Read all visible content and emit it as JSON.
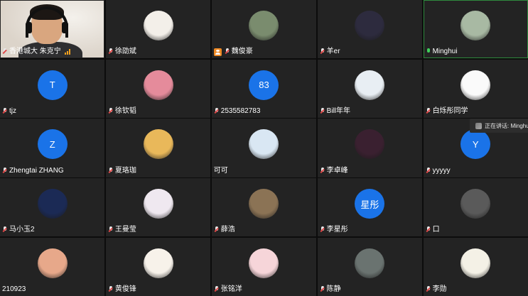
{
  "participants": [
    {
      "name": "香港城大 朱克宁",
      "kind": "video",
      "mic": "muted",
      "signal": true
    },
    {
      "name": "徐劭斌",
      "kind": "avatar",
      "icon": "woman-cartoon-avatar",
      "bg": "#f3efe9",
      "mic": "muted"
    },
    {
      "name": "魏俊豪",
      "kind": "avatar",
      "icon": "panda-photo-avatar",
      "bg": "#7a8c6e",
      "mic": "muted",
      "host": true
    },
    {
      "name": "羊er",
      "kind": "avatar",
      "icon": "person-silhouette-avatar",
      "bg": "#2d2b3e",
      "mic": "muted"
    },
    {
      "name": "Minghui",
      "kind": "avatar",
      "icon": "goose-photo-avatar",
      "bg": "#a8b9a3",
      "mic": "on",
      "active": true
    },
    {
      "name": "tjz",
      "kind": "letter",
      "letter": "T",
      "mic": "muted"
    },
    {
      "name": "徐钦韬",
      "kind": "avatar",
      "icon": "pink-creature-avatar",
      "bg": "#e58b9b",
      "mic": "muted"
    },
    {
      "name": "2535582783",
      "kind": "letter",
      "letter": "83",
      "mic": "muted"
    },
    {
      "name": "Bill年年",
      "kind": "avatar",
      "icon": "glasses-boy-avatar",
      "bg": "#e8eef3",
      "mic": "muted"
    },
    {
      "name": "白烁彤同学",
      "kind": "avatar",
      "icon": "sketch-girl-avatar",
      "bg": "#fafafa",
      "mic": "muted"
    },
    {
      "name": "Zhengtai ZHANG",
      "kind": "letter",
      "letter": "Z",
      "mic": "muted"
    },
    {
      "name": "夏珞珈",
      "kind": "avatar",
      "icon": "anime-girl-avatar",
      "bg": "#e9b85a",
      "mic": "muted"
    },
    {
      "name": "可可",
      "kind": "avatar",
      "icon": "cartoon-group-avatar",
      "bg": "#d9e7f3",
      "mic": "none"
    },
    {
      "name": "李卓峰",
      "kind": "avatar",
      "icon": "stage-figure-avatar",
      "bg": "#3a2030",
      "mic": "muted"
    },
    {
      "name": "yyyyy",
      "kind": "letter",
      "letter": "Y",
      "mic": "muted"
    },
    {
      "name": "马小玉2",
      "kind": "avatar",
      "icon": "blue-abstract-avatar",
      "bg": "#1b2a55",
      "mic": "muted"
    },
    {
      "name": "王曼莹",
      "kind": "avatar",
      "icon": "purple-anime-avatar",
      "bg": "#efe8f0",
      "mic": "muted"
    },
    {
      "name": "薛浩",
      "kind": "avatar",
      "icon": "child-photo-avatar",
      "bg": "#8b7355",
      "mic": "muted"
    },
    {
      "name": "李星彤",
      "kind": "letter",
      "letter": "星彤",
      "mic": "muted"
    },
    {
      "name": "口",
      "kind": "avatar",
      "icon": "grayscale-photo-avatar",
      "bg": "#5a5a5a",
      "mic": "muted"
    },
    {
      "name": "210923",
      "kind": "avatar",
      "icon": "balloons-avatar",
      "bg": "#e7a88a",
      "mic": "none"
    },
    {
      "name": "黄俊锋",
      "kind": "avatar",
      "icon": "bear-cartoon-avatar",
      "bg": "#f7f2ea",
      "mic": "muted"
    },
    {
      "name": "张铭洋",
      "kind": "avatar",
      "icon": "pig-cartoon-avatar",
      "bg": "#f6d5d9",
      "mic": "muted"
    },
    {
      "name": "陈静",
      "kind": "avatar",
      "icon": "dark-portrait-avatar",
      "bg": "#6a7370",
      "mic": "muted"
    },
    {
      "name": "李勋",
      "kind": "avatar",
      "icon": "angel-cartoon-avatar",
      "bg": "#f4f1e6",
      "mic": "muted"
    }
  ],
  "speaking_indicator": {
    "label": "正在讲话: Minghu"
  },
  "colors": {
    "tile_bg": "#232323",
    "letter_avatar": "#1a73e8",
    "active_border": "#2f8a3e",
    "host_badge": "#f08a24"
  }
}
